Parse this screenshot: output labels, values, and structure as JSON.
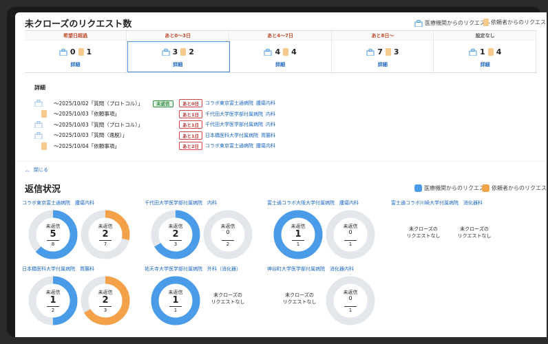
{
  "header": {
    "title": "未クローズのリクエスト数",
    "legend_hospital": "医療機関からのリクエスト",
    "legend_requester": "依頼者からのリクエスト"
  },
  "summary": [
    {
      "label": "希望日超過",
      "hospital": "0",
      "requester": "1",
      "link": "詳細",
      "color": "#c04a2a"
    },
    {
      "label": "あと0〜3日",
      "hospital": "3",
      "requester": "2",
      "link": "詳細",
      "color": "#c04a2a"
    },
    {
      "label": "あと4〜7日",
      "hospital": "4",
      "requester": "4",
      "link": "詳細",
      "color": "#c04a2a"
    },
    {
      "label": "あと8日〜",
      "hospital": "7",
      "requester": "3",
      "link": "詳細",
      "color": "#c04a2a"
    },
    {
      "label": "設定なし",
      "hospital": "1",
      "requester": "4",
      "link": "詳細",
      "color": "#555555"
    }
  ],
  "detail": {
    "title": "詳細",
    "rows": [
      {
        "type": "hospital",
        "text": "〜2025/10/02「質問（プロトコル）」",
        "status": "未返信",
        "days": "あと0日",
        "hospital": "コラボ東京富士通病院",
        "dept": "腫瘍内科"
      },
      {
        "type": "requester",
        "text": "〜2025/10/03「依頼事項」",
        "status": "",
        "days": "あと1日",
        "hospital": "千代田大学医学部付属病院",
        "dept": "内科"
      },
      {
        "type": "hospital",
        "text": "〜2025/10/03「質問（プロトコル）」",
        "status": "",
        "days": "あと1日",
        "hospital": "千代田大学医学部付属病院",
        "dept": "内科"
      },
      {
        "type": "hospital",
        "text": "〜2025/10/03「質問（逸脱）」",
        "status": "",
        "days": "あと1日",
        "hospital": "日本橋医科大学付属病院",
        "dept": "胃腸科"
      },
      {
        "type": "requester",
        "text": "〜2025/10/04「依頼事項」",
        "status": "",
        "days": "あと2日",
        "hospital": "コラボ東京富士通病院",
        "dept": "腫瘍内科"
      }
    ],
    "close_label": "閉じる"
  },
  "reply": {
    "title": "返信状況",
    "legend_hospital": "医療機関からのリクエスト",
    "legend_requester": "依頼者からのリクエスト",
    "color_hospital": "#4a9be8",
    "color_requester": "#f4a24a",
    "unreplied_label": "未返信",
    "no_request_label": "未クローズの\nリクエストなし",
    "hospitals": [
      {
        "name": "コラボ東京富士通病院　腫瘍内科",
        "hospital": {
          "unreplied": 5,
          "total": 8
        },
        "requester": {
          "unreplied": 2,
          "total": 7
        }
      },
      {
        "name": "千代田大学医学部付属病院　内科",
        "hospital": {
          "unreplied": 2,
          "total": 3
        },
        "requester": {
          "unreplied": 0,
          "total": 2
        }
      },
      {
        "name": "富士通コラボ大阪大学付属病院　腫瘍内科",
        "hospital": {
          "unreplied": 1,
          "total": 1
        },
        "requester": {
          "unreplied": 0,
          "total": 1
        }
      },
      {
        "name": "富士通コラボ川崎大学付属病院　消化器科",
        "hospital": null,
        "requester": null
      },
      {
        "name": "日本橋医科大学付属病院　胃腸科",
        "hospital": {
          "unreplied": 1,
          "total": 2
        },
        "requester": {
          "unreplied": 2,
          "total": 3
        }
      },
      {
        "name": "祐天寺大学医学部付属病院　外科（消化器）",
        "hospital": {
          "unreplied": 1,
          "total": 1
        },
        "requester": null
      },
      {
        "name": "神谷町大学医学部付属病院　消化器内科",
        "hospital": null,
        "requester": {
          "unreplied": 0,
          "total": 1
        }
      }
    ]
  }
}
